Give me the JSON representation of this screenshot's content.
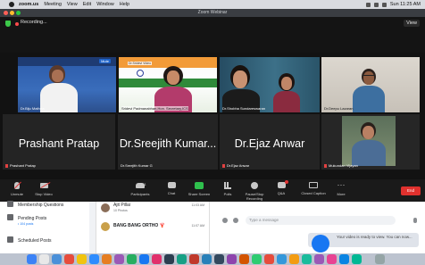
{
  "menubar": {
    "app": "zoom.us",
    "items": [
      "Meeting",
      "View",
      "Edit",
      "Window",
      "Help"
    ],
    "clock": "Sun 11:25 AM"
  },
  "window": {
    "title": "Zoom Webinar"
  },
  "recording": {
    "label": "Recording...",
    "view_label": "View"
  },
  "gallery": {
    "tiles": [
      {
        "name": "Dr.Biju Mathew",
        "mute_badge": "Mute"
      },
      {
        "name": "Sridevi Padmanabhan,Hon. Secretary,ICS",
        "overlay": "Dr.Sridevi Video"
      },
      {
        "name": "Dr.Shobha Sundareswaran"
      },
      {
        "name": "Dr.Deepu Lazaran"
      },
      {
        "big": "Prashant Pratap",
        "name": "Prashant Pratap"
      },
      {
        "big": "Dr.Sreejith Kumar...",
        "name": "Dr.Sreejith Kumar G"
      },
      {
        "big": "Dr.Ejaz Anwar",
        "name": "Dr.Ejaz Anwar"
      },
      {
        "name": "Mukundan Vijayan"
      }
    ]
  },
  "toolbar": {
    "unmute": "Unmute",
    "stop_video": "Stop Video",
    "participants": "Participants",
    "participants_count": "131",
    "chat": "Chat",
    "share_screen": "Share Screen",
    "polls": "Polls",
    "record": "Pause/Stop Recording",
    "qa": "Q&A",
    "closed_caption": "Closed Caption",
    "more": "More",
    "end": "End"
  },
  "facebook": {
    "sidebar": [
      {
        "label": "Membership Questions"
      },
      {
        "label": "Pending Posts",
        "sub": "• 104 posts"
      },
      {
        "label": "Scheduled Posts"
      }
    ],
    "chats": [
      {
        "name": "Ajit Pillai",
        "sub": "10 Photos",
        "time": "11:03 AM"
      },
      {
        "name": "BANG BANG ORTHO 🦞",
        "sub": "",
        "time": "11:07 AM"
      }
    ],
    "message_placeholder": "Type a message",
    "notice": "Your video is ready to view. You can now..."
  },
  "colors": {
    "end_button": "#e0312e",
    "active_speaker": "#b9e22e",
    "share_screen": "#2fc04d",
    "recording_dot": "#ff4a4a"
  },
  "icons": [
    "apple-icon",
    "shield-icon",
    "mic-muted-icon",
    "video-off-icon",
    "participants-icon",
    "chat-icon",
    "share-screen-icon",
    "polls-icon",
    "record-icon",
    "qa-icon",
    "caption-icon",
    "more-icon",
    "emoji-icon",
    "attach-icon",
    "mic-icon"
  ]
}
